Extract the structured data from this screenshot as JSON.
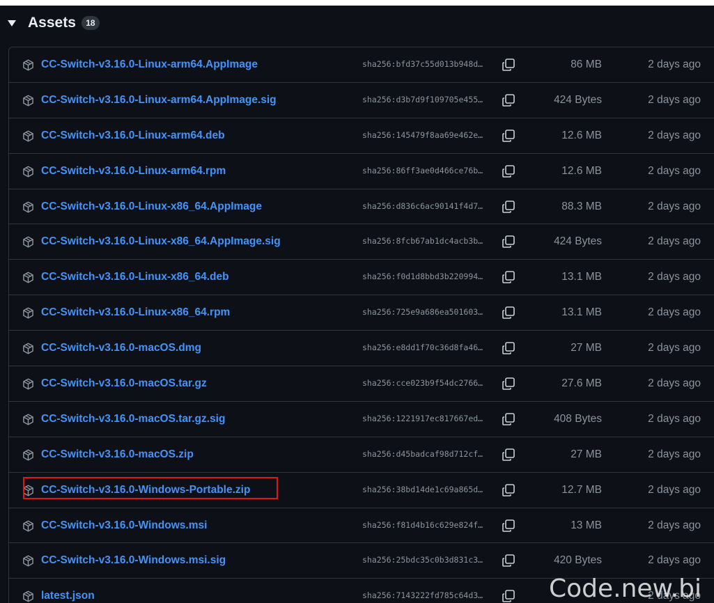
{
  "assets": {
    "title": "Assets",
    "count": "18",
    "items": [
      {
        "name": "CC-Switch-v3.16.0-Linux-arm64.AppImage",
        "sha": "sha256:bfd37c55d013b948d…",
        "size": "86 MB",
        "date": "2 days ago"
      },
      {
        "name": "CC-Switch-v3.16.0-Linux-arm64.AppImage.sig",
        "sha": "sha256:d3b7d9f109705e455…",
        "size": "424 Bytes",
        "date": "2 days ago"
      },
      {
        "name": "CC-Switch-v3.16.0-Linux-arm64.deb",
        "sha": "sha256:145479f8aa69e462e…",
        "size": "12.6 MB",
        "date": "2 days ago"
      },
      {
        "name": "CC-Switch-v3.16.0-Linux-arm64.rpm",
        "sha": "sha256:86ff3ae0d466ce76b…",
        "size": "12.6 MB",
        "date": "2 days ago"
      },
      {
        "name": "CC-Switch-v3.16.0-Linux-x86_64.AppImage",
        "sha": "sha256:d836c6ac90141f4d7…",
        "size": "88.3 MB",
        "date": "2 days ago"
      },
      {
        "name": "CC-Switch-v3.16.0-Linux-x86_64.AppImage.sig",
        "sha": "sha256:8fcb67ab1dc4acb3b…",
        "size": "424 Bytes",
        "date": "2 days ago"
      },
      {
        "name": "CC-Switch-v3.16.0-Linux-x86_64.deb",
        "sha": "sha256:f0d1d8bbd3b220994…",
        "size": "13.1 MB",
        "date": "2 days ago"
      },
      {
        "name": "CC-Switch-v3.16.0-Linux-x86_64.rpm",
        "sha": "sha256:725e9a686ea501603…",
        "size": "13.1 MB",
        "date": "2 days ago"
      },
      {
        "name": "CC-Switch-v3.16.0-macOS.dmg",
        "sha": "sha256:e8dd1f70c36d8fa46…",
        "size": "27 MB",
        "date": "2 days ago"
      },
      {
        "name": "CC-Switch-v3.16.0-macOS.tar.gz",
        "sha": "sha256:cce023b9f54dc2766…",
        "size": "27.6 MB",
        "date": "2 days ago"
      },
      {
        "name": "CC-Switch-v3.16.0-macOS.tar.gz.sig",
        "sha": "sha256:1221917ec817667ed…",
        "size": "408 Bytes",
        "date": "2 days ago"
      },
      {
        "name": "CC-Switch-v3.16.0-macOS.zip",
        "sha": "sha256:d45badcaf98d712cf…",
        "size": "27 MB",
        "date": "2 days ago"
      },
      {
        "name": "CC-Switch-v3.16.0-Windows-Portable.zip",
        "sha": "sha256:38bd14de1c69a865d…",
        "size": "12.7 MB",
        "date": "2 days ago"
      },
      {
        "name": "CC-Switch-v3.16.0-Windows.msi",
        "sha": "sha256:f81d4b16c629e824f…",
        "size": "13 MB",
        "date": "2 days ago"
      },
      {
        "name": "CC-Switch-v3.16.0-Windows.msi.sig",
        "sha": "sha256:25bdc35c0b3d831c3…",
        "size": "420 Bytes",
        "date": "2 days ago"
      },
      {
        "name": "latest.json",
        "sha": "sha256:7143222fd785c64d3…",
        "size": "",
        "date": "2 days ago"
      }
    ]
  },
  "watermark": "Code.new.bi",
  "icons": {
    "row_icon": "package-icon",
    "copy_icon": "copy-icon",
    "toggle_icon": "triangle-down-icon"
  },
  "colors": {
    "background": "#0d1117",
    "link": "#4493f8",
    "muted": "#8b949e",
    "border": "#30363d",
    "highlight": "#e0161b"
  }
}
